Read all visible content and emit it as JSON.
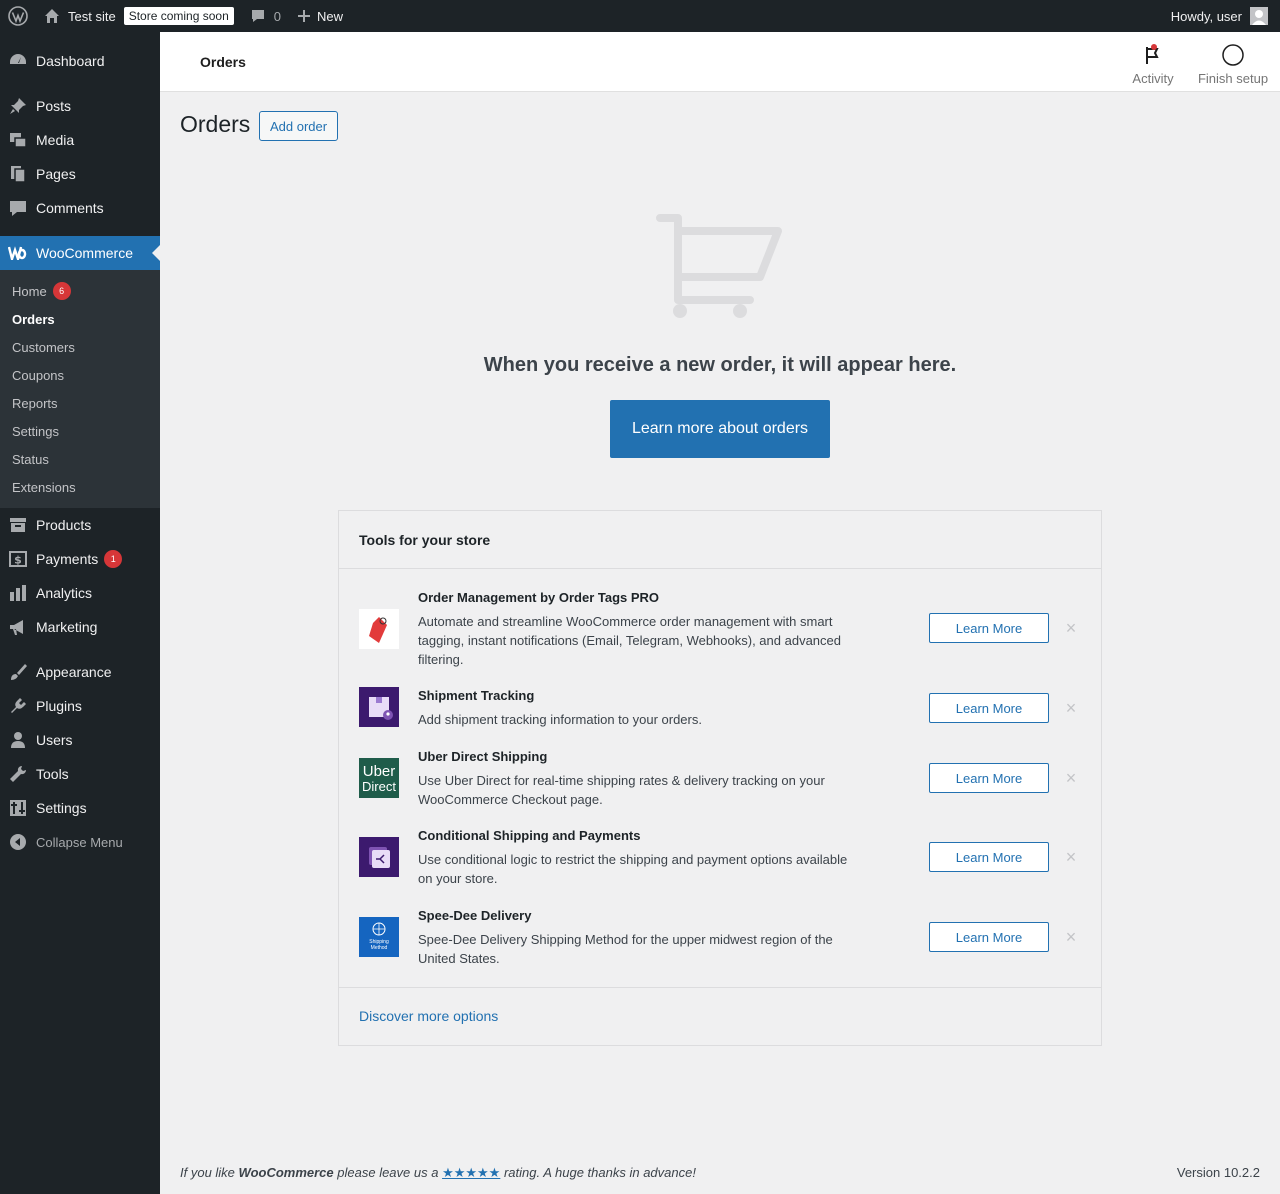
{
  "adminbar": {
    "site_name": "Test site",
    "store_badge": "Store coming soon",
    "comments_count": "0",
    "new_label": "New",
    "howdy": "Howdy, user"
  },
  "sidebar": {
    "items": [
      {
        "label": "Dashboard",
        "icon": "dashboard-icon"
      },
      {
        "label": "Posts",
        "icon": "pin-icon"
      },
      {
        "label": "Media",
        "icon": "media-icon"
      },
      {
        "label": "Pages",
        "icon": "pages-icon"
      },
      {
        "label": "Comments",
        "icon": "comment-icon"
      },
      {
        "label": "WooCommerce",
        "icon": "woo-icon"
      },
      {
        "label": "Products",
        "icon": "archive-icon"
      },
      {
        "label": "Payments",
        "icon": "payments-icon",
        "badge": "1"
      },
      {
        "label": "Analytics",
        "icon": "bar-chart-icon"
      },
      {
        "label": "Marketing",
        "icon": "megaphone-icon"
      },
      {
        "label": "Appearance",
        "icon": "brush-icon"
      },
      {
        "label": "Plugins",
        "icon": "plug-icon"
      },
      {
        "label": "Users",
        "icon": "user-icon"
      },
      {
        "label": "Tools",
        "icon": "wrench-icon"
      },
      {
        "label": "Settings",
        "icon": "sliders-icon"
      }
    ],
    "submenu": [
      {
        "label": "Home",
        "badge": "6"
      },
      {
        "label": "Orders"
      },
      {
        "label": "Customers"
      },
      {
        "label": "Coupons"
      },
      {
        "label": "Reports"
      },
      {
        "label": "Settings"
      },
      {
        "label": "Status"
      },
      {
        "label": "Extensions"
      }
    ],
    "collapse": "Collapse Menu"
  },
  "header": {
    "title": "Orders",
    "activity": "Activity",
    "finish_setup": "Finish setup"
  },
  "page": {
    "title": "Orders",
    "add_order": "Add order",
    "empty_message": "When you receive a new order, it will appear here.",
    "learn_more_orders": "Learn more about orders"
  },
  "tools": {
    "heading": "Tools for your store",
    "items": [
      {
        "name": "Order Management by Order Tags PRO",
        "desc": "Automate and streamline WooCommerce order management with smart tagging, instant notifications (Email, Telegram, Webhooks), and advanced filtering.",
        "button": "Learn More"
      },
      {
        "name": "Shipment Tracking",
        "desc": "Add shipment tracking information to your orders.",
        "button": "Learn More"
      },
      {
        "name": "Uber Direct Shipping",
        "desc": "Use Uber Direct for real-time shipping rates & delivery tracking on your WooCommerce Checkout page.",
        "button": "Learn More",
        "logo_text": "Uber",
        "logo_text2": "Direct"
      },
      {
        "name": "Conditional Shipping and Payments",
        "desc": "Use conditional logic to restrict the shipping and payment options available on your store.",
        "button": "Learn More"
      },
      {
        "name": "Spee-Dee Delivery",
        "desc": "Spee-Dee Delivery Shipping Method for the upper midwest region of the United States.",
        "button": "Learn More",
        "logo_text": "Shipping",
        "logo_text2": "Method"
      }
    ],
    "discover": "Discover more options"
  },
  "footer": {
    "left_pre": "If you like ",
    "left_brand": "WooCommerce",
    "left_mid": " please leave us a ",
    "stars": "★★★★★",
    "left_post": " rating. A huge thanks in advance!",
    "version": "Version 10.2.2"
  },
  "colors": {
    "accent": "#2271b1",
    "sidebar_bg": "#1d2327",
    "badge_red": "#d63638"
  }
}
